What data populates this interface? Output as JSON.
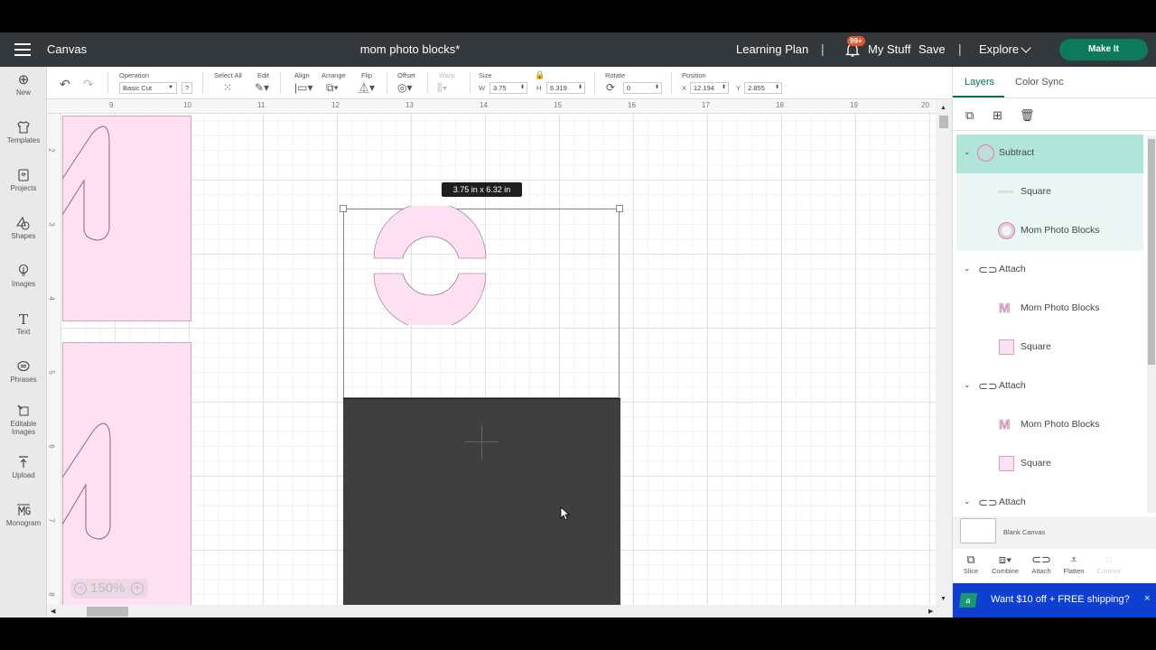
{
  "header": {
    "app_name": "Canvas",
    "doc_title": "mom photo blocks*",
    "learning_plan": "Learning Plan",
    "notification_badge": "99+",
    "my_stuff": "My Stuff",
    "save": "Save",
    "explore": "Explore",
    "make_it": "Make It",
    "separator": "|"
  },
  "sidebar": {
    "items": [
      {
        "label": "New",
        "icon": "⊕"
      },
      {
        "label": "Templates",
        "icon": "👕"
      },
      {
        "label": "Projects",
        "icon": "▣"
      },
      {
        "label": "Shapes",
        "icon": "△"
      },
      {
        "label": "Images",
        "icon": "💡"
      },
      {
        "label": "Text",
        "icon": "T"
      },
      {
        "label": "Phrases",
        "icon": "💬"
      },
      {
        "label": "Editable",
        "label2": "Images",
        "icon": "⌖"
      },
      {
        "label": "Upload",
        "icon": "⤒"
      },
      {
        "label": "Monogram",
        "icon": "₥"
      }
    ]
  },
  "toolbar": {
    "undo_icon": "↶",
    "redo_icon": "↷",
    "operation_label": "Operation",
    "operation_value": "Basic Cut",
    "help": "?",
    "select_all": "Select All",
    "edit": "Edit",
    "align": "Align",
    "arrange": "Arrange",
    "flip": "Flip",
    "offset": "Offset",
    "warp": "Warp",
    "size": "Size",
    "w_label": "W",
    "w_value": "3.75",
    "h_label": "H",
    "h_value": "6.319",
    "rotate": "Rotate",
    "rotate_value": "0",
    "position": "Position",
    "x_label": "X",
    "x_value": "12.194",
    "y_label": "Y",
    "y_value": "2.855"
  },
  "canvas": {
    "ruler_top": [
      "9",
      "10",
      "11",
      "12",
      "13",
      "14",
      "15",
      "16",
      "17",
      "18",
      "19",
      "20"
    ],
    "ruler_left": [
      "2",
      "3",
      "4",
      "5",
      "6",
      "7",
      "8"
    ],
    "dimension_tooltip": "3.75  in x 6.32  in",
    "zoom_level": "150%",
    "zoom_out": "−",
    "zoom_in": "+"
  },
  "panel": {
    "tabs": [
      "Layers",
      "Color Sync"
    ],
    "layers": [
      {
        "name": "Subtract",
        "type": "group",
        "icon": "subtract-ring"
      },
      {
        "name": "Square",
        "type": "child",
        "icon": "line"
      },
      {
        "name": "Mom Photo Blocks",
        "type": "child",
        "icon": "ring"
      },
      {
        "name": "Attach",
        "type": "group",
        "icon": "paperclip"
      },
      {
        "name": "Mom Photo Blocks",
        "type": "child",
        "icon": "M"
      },
      {
        "name": "Square",
        "type": "child",
        "icon": "square"
      },
      {
        "name": "Attach",
        "type": "group",
        "icon": "paperclip"
      },
      {
        "name": "Mom Photo Blocks",
        "type": "child",
        "icon": "M"
      },
      {
        "name": "Square",
        "type": "child",
        "icon": "square"
      },
      {
        "name": "Attach",
        "type": "group",
        "icon": "paperclip"
      }
    ],
    "blank_canvas": "Blank Canvas",
    "bottom_tools": [
      "Slice",
      "Combine",
      "Attach",
      "Flatten",
      "Contour"
    ],
    "promo": "Want $10 off + FREE shipping?",
    "promo_logo": "a",
    "promo_close": "×"
  },
  "colors": {
    "header_bg": "#33383d",
    "make_it": "#0d7a5c",
    "accent": "#0d6e55",
    "layer_selected": "#b1e5da",
    "pink_material": "#fde0f2",
    "dark_rect": "#3f3f3f",
    "promo_bg": "#0f3fd1"
  }
}
